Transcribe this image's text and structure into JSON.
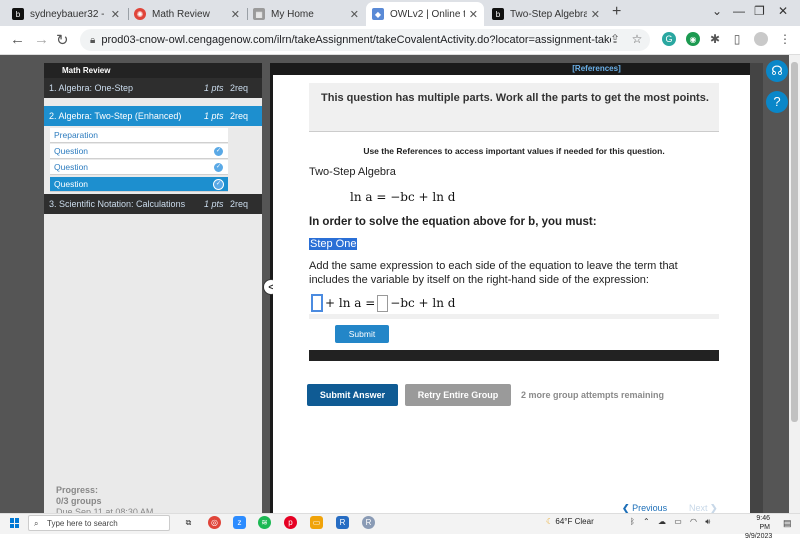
{
  "browser": {
    "tabs": [
      {
        "title": "sydneybauer32 - bra",
        "icon": "brainly-icon",
        "color": "#111111"
      },
      {
        "title": "Math Review",
        "icon": "cengage-icon",
        "color": "#e0453a"
      },
      {
        "title": "My Home",
        "icon": "cengage-home-icon",
        "color": "#7a7a7a"
      },
      {
        "title": "OWLv2 | Online teac",
        "icon": "owl-icon",
        "color": "#5a8ad6"
      },
      {
        "title": "Two-Step Algebra a",
        "icon": "brainly-icon",
        "color": "#111111"
      }
    ],
    "active_tab_index": 3,
    "url": "prod03-cnow-owl.cengagenow.com/ilrn/takeAssignment/takeCovalentActivity.do?locator=assignment-take"
  },
  "sidebar": {
    "header": "Math Review",
    "items": [
      {
        "label": "1. Algebra: One-Step",
        "pts": "1 pts",
        "req": "2req"
      },
      {
        "label": "2. Algebra: Two-Step (Enhanced)",
        "pts": "1 pts",
        "req": "2req"
      },
      {
        "label": "3. Scientific Notation: Calculations",
        "pts": "1 pts",
        "req": "2req"
      }
    ],
    "subitems": [
      {
        "label": "Preparation"
      },
      {
        "label": "Question"
      },
      {
        "label": "Question"
      },
      {
        "label": "Question"
      }
    ],
    "progress_label": "Progress:",
    "progress_value": "0/3 groups",
    "due": "Due Sep 11 at 08:30 AM"
  },
  "header": {
    "references": "[References]"
  },
  "question": {
    "notice": "This question has multiple parts. Work all the parts to get the most points.",
    "references_note": "Use the References to access important values if needed for this question.",
    "title": "Two-Step Algebra",
    "equation": "ln a = −bc + ln d",
    "instruction": "In order to solve the equation above for b, you must:",
    "step": "Step One",
    "step_description": "Add the same expression to each side of the equation to leave the term that includes the variable by itself on the right-hand side of the expression:",
    "answer_left": "+ ln a =",
    "answer_right": "−bc + ln d",
    "submit_label": "Submit"
  },
  "actions": {
    "submit_answer": "Submit Answer",
    "retry_group": "Retry Entire Group",
    "attempts": "2 more group attempts remaining",
    "previous": "Previous",
    "next": "Next"
  },
  "taskbar": {
    "search_placeholder": "Type here to search",
    "weather": "64°F  Clear",
    "time": "9:46 PM",
    "date": "9/9/2023"
  }
}
